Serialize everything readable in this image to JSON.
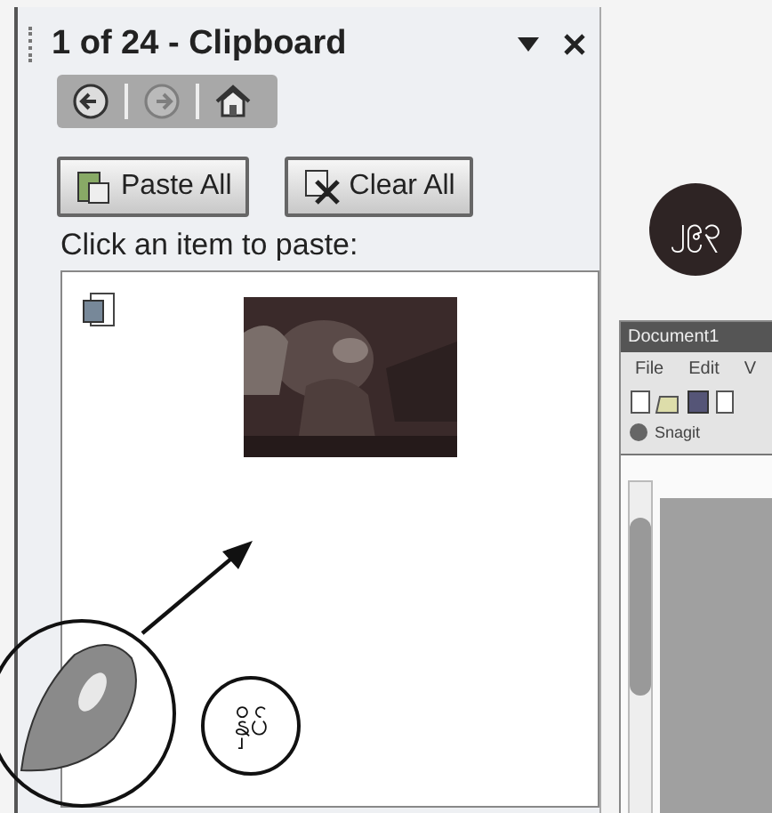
{
  "task_pane": {
    "title": "1 of 24 - Clipboard",
    "nav": [
      {
        "kind": "back",
        "disabled": false
      },
      {
        "kind": "forward",
        "disabled": true
      },
      {
        "kind": "home",
        "disabled": false
      }
    ],
    "buttons": [
      {
        "kind": "paste",
        "label": "Paste All"
      },
      {
        "kind": "clear",
        "label": "Clear All"
      }
    ],
    "prompt": "Click an item to paste:"
  },
  "word_window": {
    "title": "Document1",
    "menu": [
      "File",
      "Edit",
      "V"
    ],
    "toolbar_label": "Snagit"
  },
  "annotations": [
    {
      "kind": "badge",
      "text": "၂၉၃"
    },
    {
      "kind": "label",
      "text": "နှိပ်"
    }
  ]
}
